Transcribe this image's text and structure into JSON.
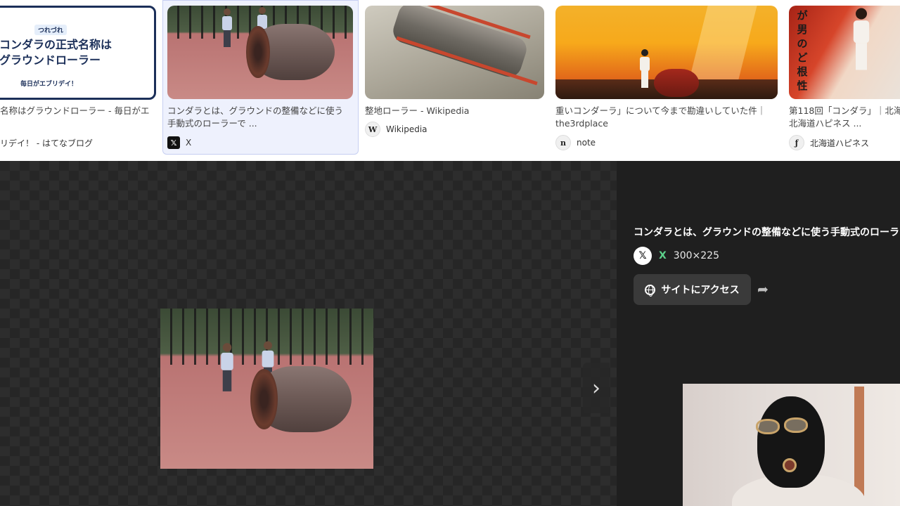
{
  "results": [
    {
      "banner_tag": "つれづれ",
      "banner_title_lines": [
        "コンダラの正式名称は",
        "グラウンドローラー"
      ],
      "banner_footer": "毎日がエブリデイ！",
      "caption_lines": [
        "名称はグラウンドローラー - 毎日がエ",
        "リデイ！ - はてなブログ"
      ],
      "source": ""
    },
    {
      "caption_lines": [
        "コンダラとは、グラウンドの整備などに使う",
        "手動式のローラーで ..."
      ],
      "source": "X",
      "favicon": "x-logo-icon",
      "selected": true
    },
    {
      "caption_lines": [
        "整地ローラー - Wikipedia"
      ],
      "source": "Wikipedia",
      "favicon": "wikipedia-icon"
    },
    {
      "caption_lines": [
        "重いコンダーラ」について今まで勘違いしていた件｜",
        "the3rdplace"
      ],
      "source": "note",
      "favicon": "note-icon"
    },
    {
      "vertical_text": "が男のど根性",
      "caption_lines": [
        "第118回「コンダラ」｜北海",
        "北海道ハピネス ..."
      ],
      "source": "北海道ハピネス",
      "favicon": "hokkaido-happiness-icon"
    }
  ],
  "detail": {
    "title": "コンダラとは、グラウンドの整備などに使う手動式のローラ",
    "source_name": "X",
    "dimensions": "300×225",
    "visit_button": "サイトにアクセス",
    "share_label": "共有"
  },
  "colors": {
    "source_green": "#5cd18b",
    "selected_bg": "#eef1fd",
    "banner_navy": "#1b2f59",
    "viewer_bg": "#1f1f1f"
  }
}
